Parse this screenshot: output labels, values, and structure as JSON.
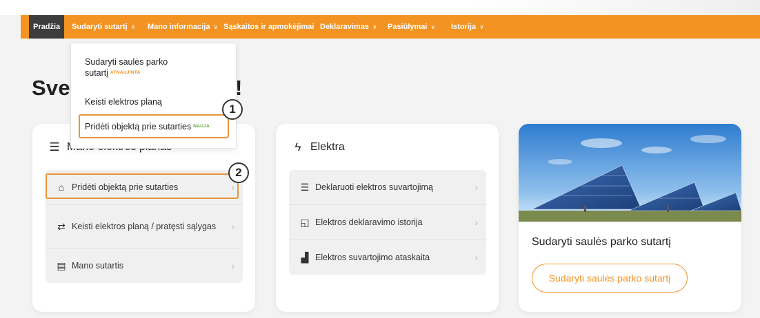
{
  "navbar": {
    "items": [
      {
        "label": "Pradžia"
      },
      {
        "label": "Sudaryti sutartį"
      },
      {
        "label": "Mano informacija"
      },
      {
        "label": "Sąskaitos ir apmokėjimai"
      },
      {
        "label": "Deklaravimas"
      },
      {
        "label": "Pasiūlymai"
      },
      {
        "label": "Istorija"
      }
    ],
    "chevron_up": "∧",
    "chevron_down": "∨"
  },
  "heading": {
    "start": "Sve",
    "end": "!"
  },
  "dropdown": {
    "items": [
      {
        "label": "Sudaryti saulės parko sutartį",
        "badge": "ATNAUJINTA"
      },
      {
        "label": "Keisti elektros planą"
      },
      {
        "label": "Pridėti objektą prie sutarties",
        "badge": "NAUJA"
      }
    ]
  },
  "cards": {
    "plan": {
      "title": "Mano elektros planas",
      "items": [
        {
          "label": "Pridėti objektą prie sutarties",
          "icon": "home-plus-icon"
        },
        {
          "label": "Keisti elektros planą / pratęsti sąlygas",
          "icon": "swap-icon"
        },
        {
          "label": "Mano sutartis",
          "icon": "document-icon"
        }
      ]
    },
    "electricity": {
      "title": "Elektra",
      "items": [
        {
          "label": "Deklaruoti elektros suvartojimą",
          "icon": "list-icon"
        },
        {
          "label": "Elektros deklaravimo istorija",
          "icon": "folder-history-icon"
        },
        {
          "label": "Elektros suvartojimo ataskaita",
          "icon": "bar-chart-icon"
        }
      ]
    },
    "solar": {
      "title": "Sudaryti saulės parko sutartį",
      "button": "Sudaryti saulės parko sutartį"
    }
  },
  "markers": [
    "1",
    "2"
  ],
  "colors": {
    "brand": "#f29322",
    "active_nav": "#3d3d3d",
    "new_badge": "#5aa732",
    "highlight": "#e8953a"
  }
}
